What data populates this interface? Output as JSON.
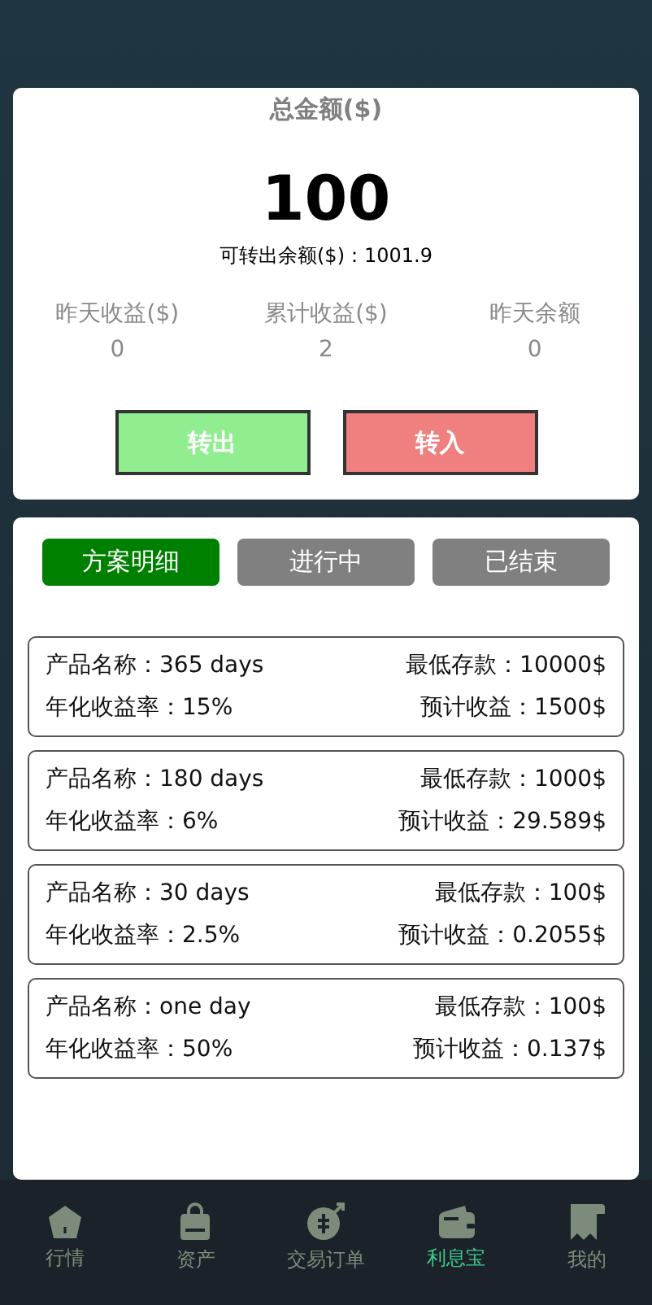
{
  "summary": {
    "title": "总金额($)",
    "total": "100",
    "transferable": "可转出余额($)：1001.9",
    "stats": [
      {
        "label": "昨天收益($)",
        "value": "0"
      },
      {
        "label": "累计收益($)",
        "value": "2"
      },
      {
        "label": "昨天余额",
        "value": "0"
      }
    ],
    "buttons": [
      {
        "label": "转出",
        "kind": "out"
      },
      {
        "label": "转入",
        "kind": "in"
      }
    ]
  },
  "tabs": [
    {
      "label": "方案明细",
      "selected": true
    },
    {
      "label": "进行中",
      "selected": false
    },
    {
      "label": "已结束",
      "selected": false
    }
  ],
  "products": [
    {
      "name": "产品名称：365 days",
      "min": "最低存款：10000$",
      "rate": "年化收益率：15%",
      "expected": "预计收益：1500$"
    },
    {
      "name": "产品名称：180 days",
      "min": "最低存款：1000$",
      "rate": "年化收益率：6%",
      "expected": "预计收益：29.589$"
    },
    {
      "name": "产品名称：30 days",
      "min": "最低存款：100$",
      "rate": "年化收益率：2.5%",
      "expected": "预计收益：0.2055$"
    },
    {
      "name": "产品名称：one day",
      "min": "最低存款：100$",
      "rate": "年化收益率：50%",
      "expected": "预计收益：0.137$"
    }
  ],
  "nav": [
    {
      "label": "行情",
      "kind": "home",
      "selected": false
    },
    {
      "label": "资产",
      "kind": "bag",
      "selected": false
    },
    {
      "label": "交易订单",
      "kind": "coin",
      "selected": false
    },
    {
      "label": "利息宝",
      "kind": "wallet",
      "selected": true
    },
    {
      "label": "我的",
      "kind": "receipt",
      "selected": false
    }
  ]
}
